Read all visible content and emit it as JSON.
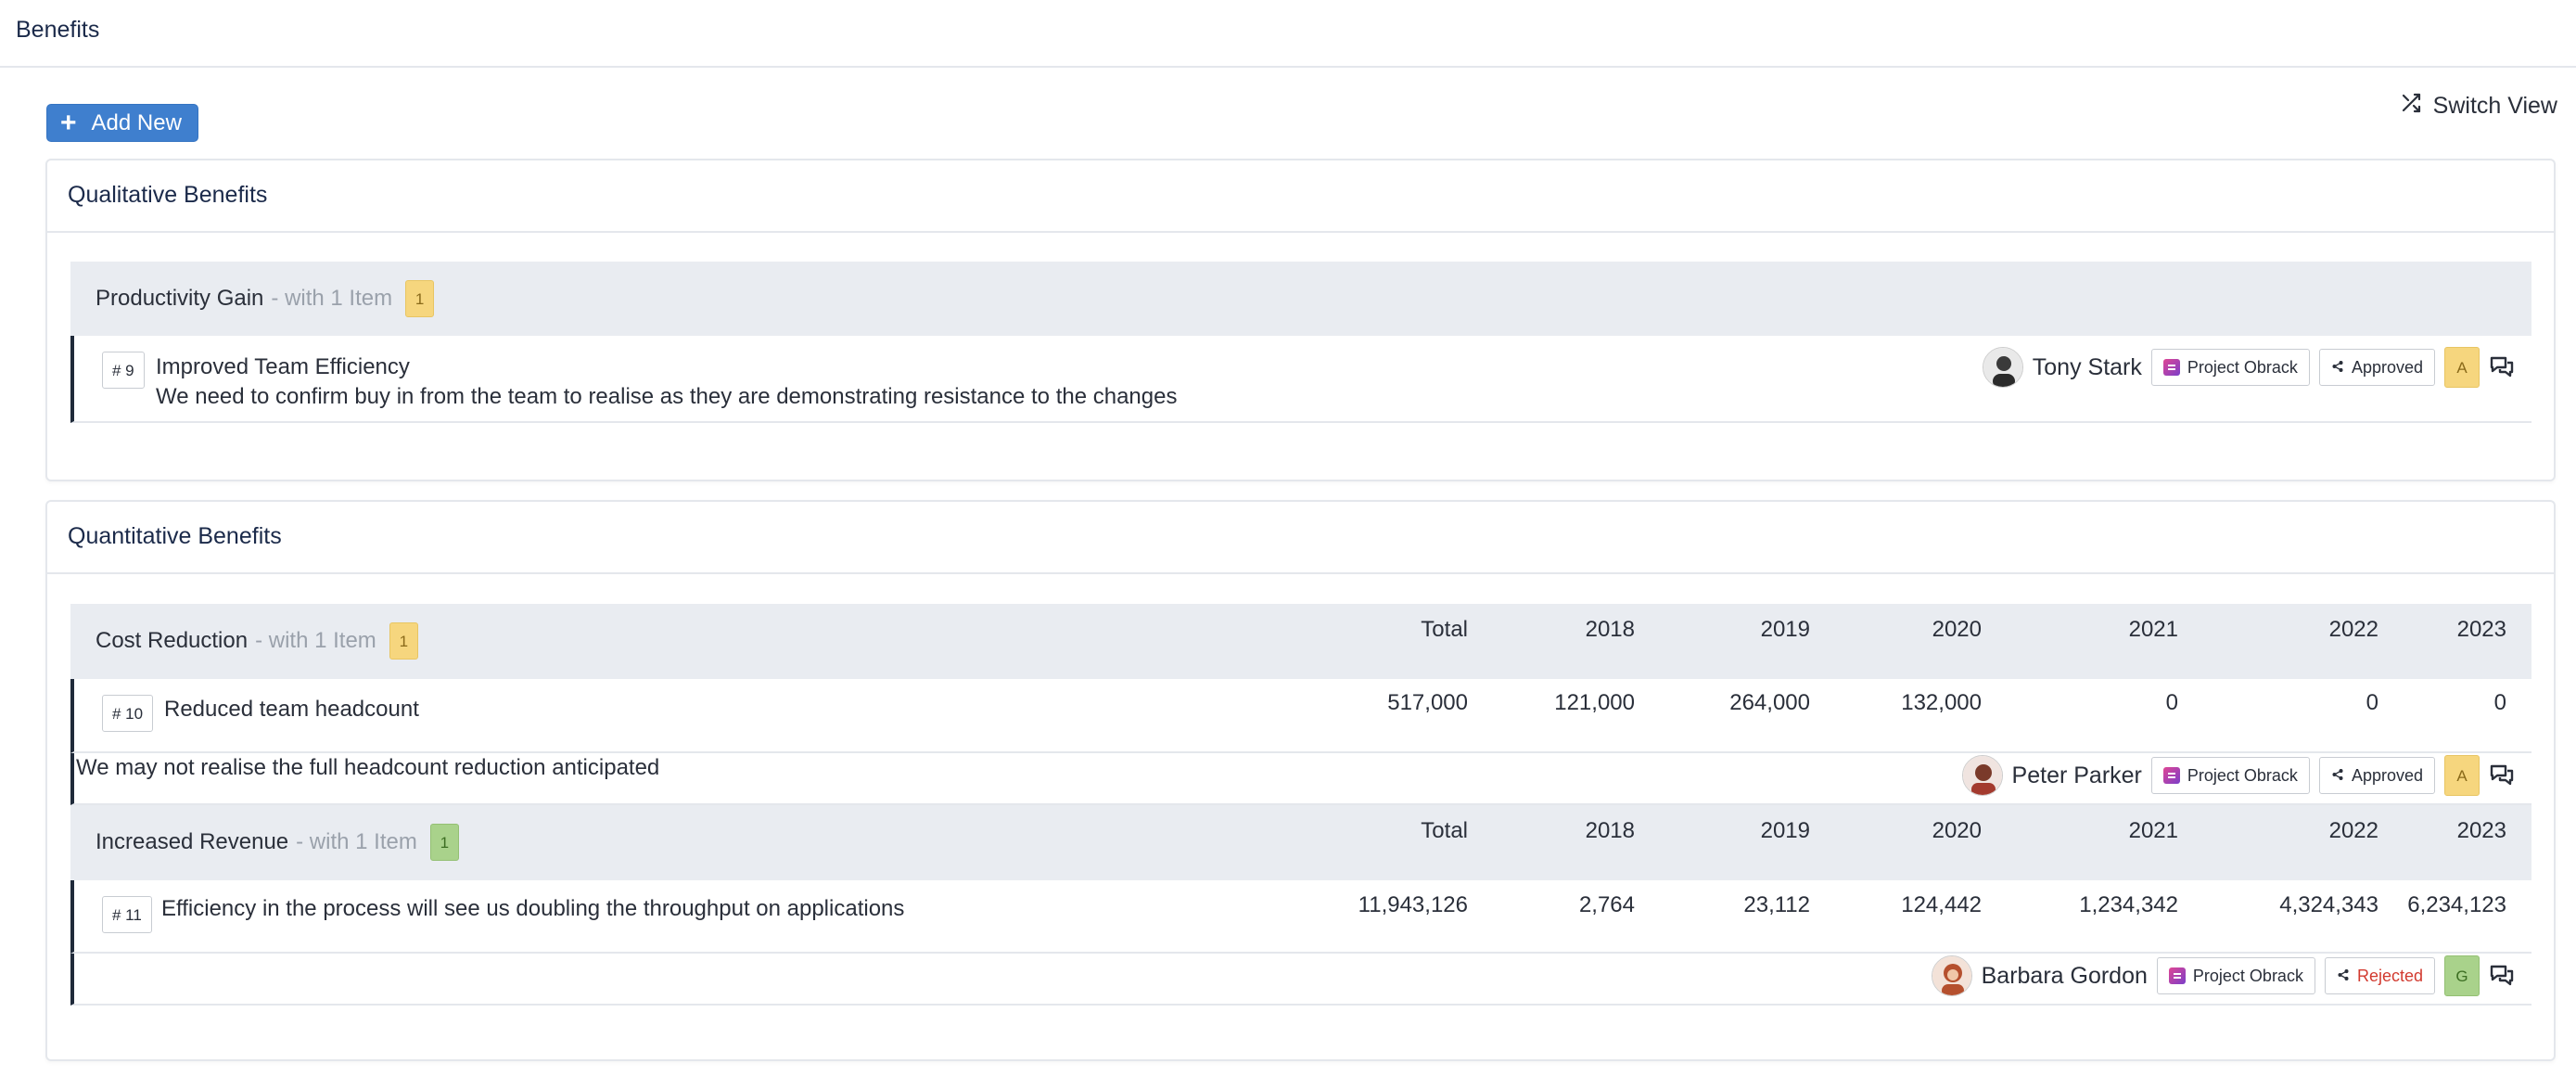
{
  "header": {
    "title": "Benefits"
  },
  "toolbar": {
    "add_label": "Add New",
    "switch_label": "Switch View"
  },
  "qualitative": {
    "title": "Qualitative Benefits",
    "group": {
      "name": "Productivity Gain",
      "suffix": "- with 1 Item",
      "count": "1",
      "count_color": "amber"
    },
    "item": {
      "id": "# 9",
      "title": "Improved Team Efficiency",
      "description": "We need to confirm buy in from the team to realise as they are demonstrating resistance to the changes",
      "owner": "Tony Stark",
      "project": "Project Obrack",
      "status": "Approved",
      "rag": "A"
    }
  },
  "quantitative": {
    "title": "Quantitative Benefits",
    "columns": [
      "Total",
      "2018",
      "2019",
      "2020",
      "2021",
      "2022",
      "2023"
    ],
    "groups": [
      {
        "name": "Cost Reduction",
        "suffix": "- with 1 Item",
        "count": "1",
        "count_color": "amber",
        "item": {
          "id": "# 10",
          "title": "Reduced team headcount",
          "values": [
            "517,000",
            "121,000",
            "264,000",
            "132,000",
            "0",
            "0",
            "0"
          ],
          "description": "We may not realise the full headcount reduction anticipated",
          "owner": "Peter Parker",
          "project": "Project Obrack",
          "status": "Approved",
          "rag": "A"
        }
      },
      {
        "name": "Increased Revenue",
        "suffix": "- with 1 Item",
        "count": "1",
        "count_color": "green",
        "item": {
          "id": "# 11",
          "title": "Efficiency in the process will see us doubling the throughput on applications",
          "values": [
            "11,943,126",
            "2,764",
            "23,112",
            "124,442",
            "1,234,342",
            "4,324,343",
            "6,234,123"
          ],
          "description": "",
          "owner": "Barbara Gordon",
          "project": "Project Obrack",
          "status": "Rejected",
          "rag": "G"
        }
      }
    ]
  }
}
